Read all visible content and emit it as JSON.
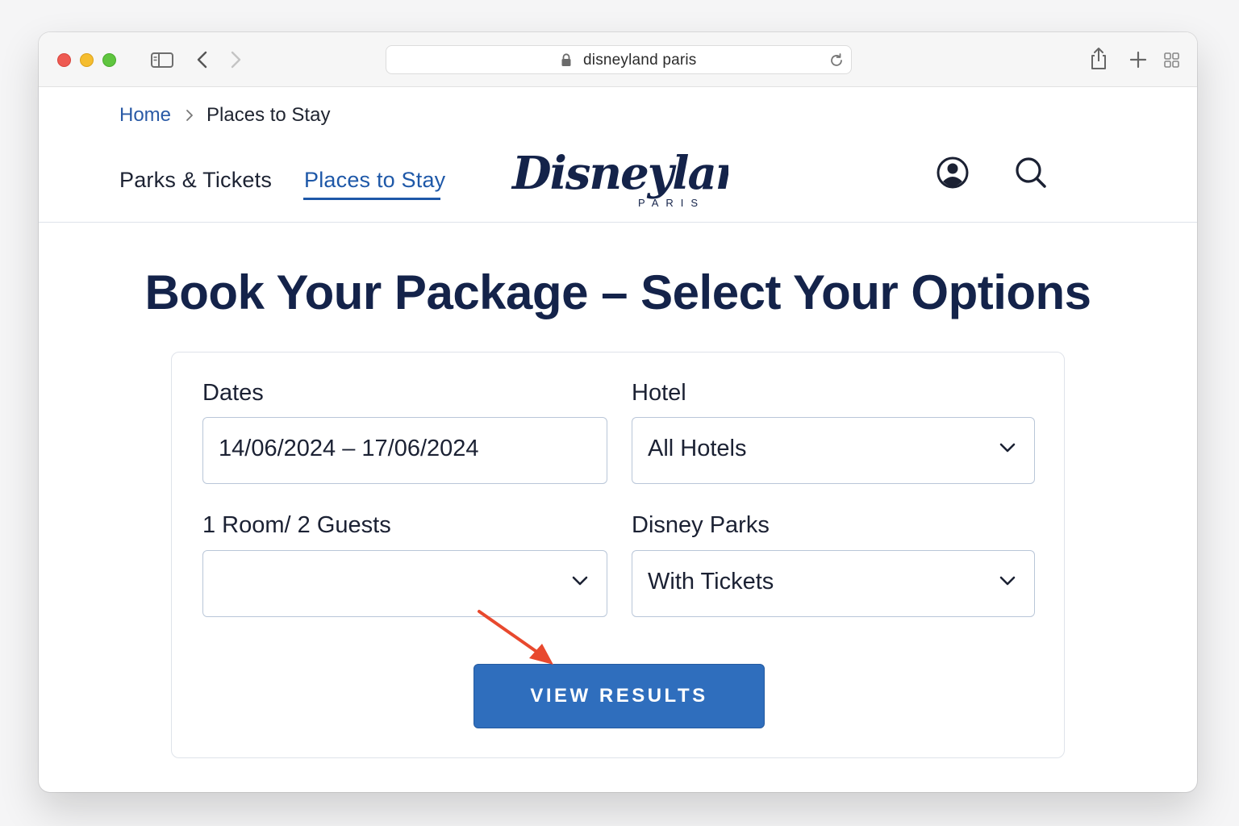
{
  "browser": {
    "url": "disneyland paris",
    "icons": [
      "sidebar-icon",
      "back-arrow-icon",
      "forward-arrow-icon",
      "lock-icon",
      "reload-icon",
      "share-icon",
      "new-tab-icon",
      "tab-overview-icon"
    ]
  },
  "breadcrumb": {
    "home": "Home",
    "separator_icon": "chevron-right-icon",
    "current": "Places to Stay"
  },
  "nav": {
    "parks_tickets": "Parks & Tickets",
    "places_to_stay": "Places to Stay",
    "active": "Places to Stay"
  },
  "logo": {
    "wordmark": "Disneyland",
    "subtitle": "PARIS"
  },
  "header_icons": [
    "account-icon",
    "search-icon"
  ],
  "page": {
    "title": "Book Your Package – Select Your Options"
  },
  "form": {
    "dates": {
      "label": "Dates",
      "value": "14/06/2024 – 17/06/2024"
    },
    "hotel": {
      "label": "Hotel",
      "value": "All Hotels"
    },
    "guests": {
      "label": "1 Room/ 2 Guests",
      "value": ""
    },
    "parks": {
      "label": "Disney Parks",
      "value": "With Tickets"
    },
    "submit_label": "VIEW RESULTS"
  },
  "colors": {
    "primary_blue": "#2f6ebd",
    "link_blue": "#1e58a8",
    "title_navy": "#14234a",
    "annotation_arrow": "#e8492e"
  }
}
